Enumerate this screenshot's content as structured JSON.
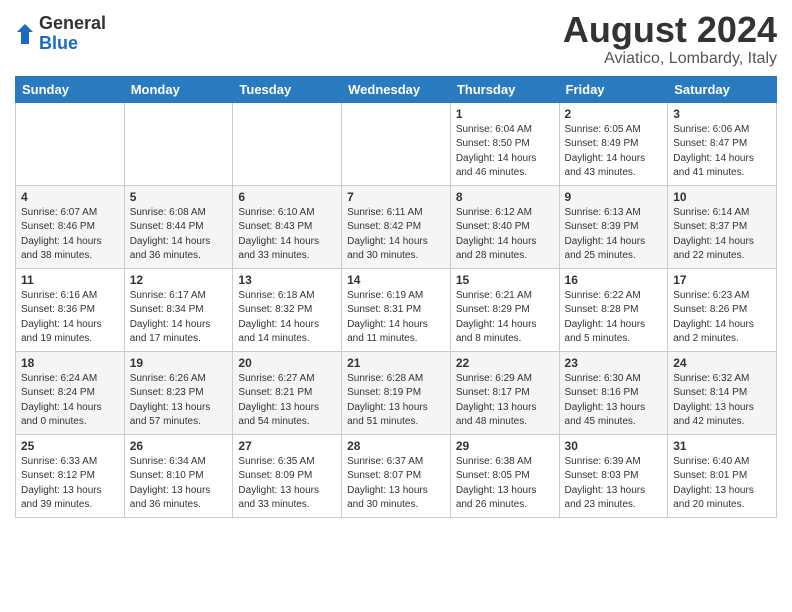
{
  "header": {
    "logo_general": "General",
    "logo_blue": "Blue",
    "month_title": "August 2024",
    "location": "Aviatico, Lombardy, Italy"
  },
  "weekdays": [
    "Sunday",
    "Monday",
    "Tuesday",
    "Wednesday",
    "Thursday",
    "Friday",
    "Saturday"
  ],
  "weeks": [
    [
      {
        "day": "",
        "info": ""
      },
      {
        "day": "",
        "info": ""
      },
      {
        "day": "",
        "info": ""
      },
      {
        "day": "",
        "info": ""
      },
      {
        "day": "1",
        "info": "Sunrise: 6:04 AM\nSunset: 8:50 PM\nDaylight: 14 hours\nand 46 minutes."
      },
      {
        "day": "2",
        "info": "Sunrise: 6:05 AM\nSunset: 8:49 PM\nDaylight: 14 hours\nand 43 minutes."
      },
      {
        "day": "3",
        "info": "Sunrise: 6:06 AM\nSunset: 8:47 PM\nDaylight: 14 hours\nand 41 minutes."
      }
    ],
    [
      {
        "day": "4",
        "info": "Sunrise: 6:07 AM\nSunset: 8:46 PM\nDaylight: 14 hours\nand 38 minutes."
      },
      {
        "day": "5",
        "info": "Sunrise: 6:08 AM\nSunset: 8:44 PM\nDaylight: 14 hours\nand 36 minutes."
      },
      {
        "day": "6",
        "info": "Sunrise: 6:10 AM\nSunset: 8:43 PM\nDaylight: 14 hours\nand 33 minutes."
      },
      {
        "day": "7",
        "info": "Sunrise: 6:11 AM\nSunset: 8:42 PM\nDaylight: 14 hours\nand 30 minutes."
      },
      {
        "day": "8",
        "info": "Sunrise: 6:12 AM\nSunset: 8:40 PM\nDaylight: 14 hours\nand 28 minutes."
      },
      {
        "day": "9",
        "info": "Sunrise: 6:13 AM\nSunset: 8:39 PM\nDaylight: 14 hours\nand 25 minutes."
      },
      {
        "day": "10",
        "info": "Sunrise: 6:14 AM\nSunset: 8:37 PM\nDaylight: 14 hours\nand 22 minutes."
      }
    ],
    [
      {
        "day": "11",
        "info": "Sunrise: 6:16 AM\nSunset: 8:36 PM\nDaylight: 14 hours\nand 19 minutes."
      },
      {
        "day": "12",
        "info": "Sunrise: 6:17 AM\nSunset: 8:34 PM\nDaylight: 14 hours\nand 17 minutes."
      },
      {
        "day": "13",
        "info": "Sunrise: 6:18 AM\nSunset: 8:32 PM\nDaylight: 14 hours\nand 14 minutes."
      },
      {
        "day": "14",
        "info": "Sunrise: 6:19 AM\nSunset: 8:31 PM\nDaylight: 14 hours\nand 11 minutes."
      },
      {
        "day": "15",
        "info": "Sunrise: 6:21 AM\nSunset: 8:29 PM\nDaylight: 14 hours\nand 8 minutes."
      },
      {
        "day": "16",
        "info": "Sunrise: 6:22 AM\nSunset: 8:28 PM\nDaylight: 14 hours\nand 5 minutes."
      },
      {
        "day": "17",
        "info": "Sunrise: 6:23 AM\nSunset: 8:26 PM\nDaylight: 14 hours\nand 2 minutes."
      }
    ],
    [
      {
        "day": "18",
        "info": "Sunrise: 6:24 AM\nSunset: 8:24 PM\nDaylight: 14 hours\nand 0 minutes."
      },
      {
        "day": "19",
        "info": "Sunrise: 6:26 AM\nSunset: 8:23 PM\nDaylight: 13 hours\nand 57 minutes."
      },
      {
        "day": "20",
        "info": "Sunrise: 6:27 AM\nSunset: 8:21 PM\nDaylight: 13 hours\nand 54 minutes."
      },
      {
        "day": "21",
        "info": "Sunrise: 6:28 AM\nSunset: 8:19 PM\nDaylight: 13 hours\nand 51 minutes."
      },
      {
        "day": "22",
        "info": "Sunrise: 6:29 AM\nSunset: 8:17 PM\nDaylight: 13 hours\nand 48 minutes."
      },
      {
        "day": "23",
        "info": "Sunrise: 6:30 AM\nSunset: 8:16 PM\nDaylight: 13 hours\nand 45 minutes."
      },
      {
        "day": "24",
        "info": "Sunrise: 6:32 AM\nSunset: 8:14 PM\nDaylight: 13 hours\nand 42 minutes."
      }
    ],
    [
      {
        "day": "25",
        "info": "Sunrise: 6:33 AM\nSunset: 8:12 PM\nDaylight: 13 hours\nand 39 minutes."
      },
      {
        "day": "26",
        "info": "Sunrise: 6:34 AM\nSunset: 8:10 PM\nDaylight: 13 hours\nand 36 minutes."
      },
      {
        "day": "27",
        "info": "Sunrise: 6:35 AM\nSunset: 8:09 PM\nDaylight: 13 hours\nand 33 minutes."
      },
      {
        "day": "28",
        "info": "Sunrise: 6:37 AM\nSunset: 8:07 PM\nDaylight: 13 hours\nand 30 minutes."
      },
      {
        "day": "29",
        "info": "Sunrise: 6:38 AM\nSunset: 8:05 PM\nDaylight: 13 hours\nand 26 minutes."
      },
      {
        "day": "30",
        "info": "Sunrise: 6:39 AM\nSunset: 8:03 PM\nDaylight: 13 hours\nand 23 minutes."
      },
      {
        "day": "31",
        "info": "Sunrise: 6:40 AM\nSunset: 8:01 PM\nDaylight: 13 hours\nand 20 minutes."
      }
    ]
  ]
}
